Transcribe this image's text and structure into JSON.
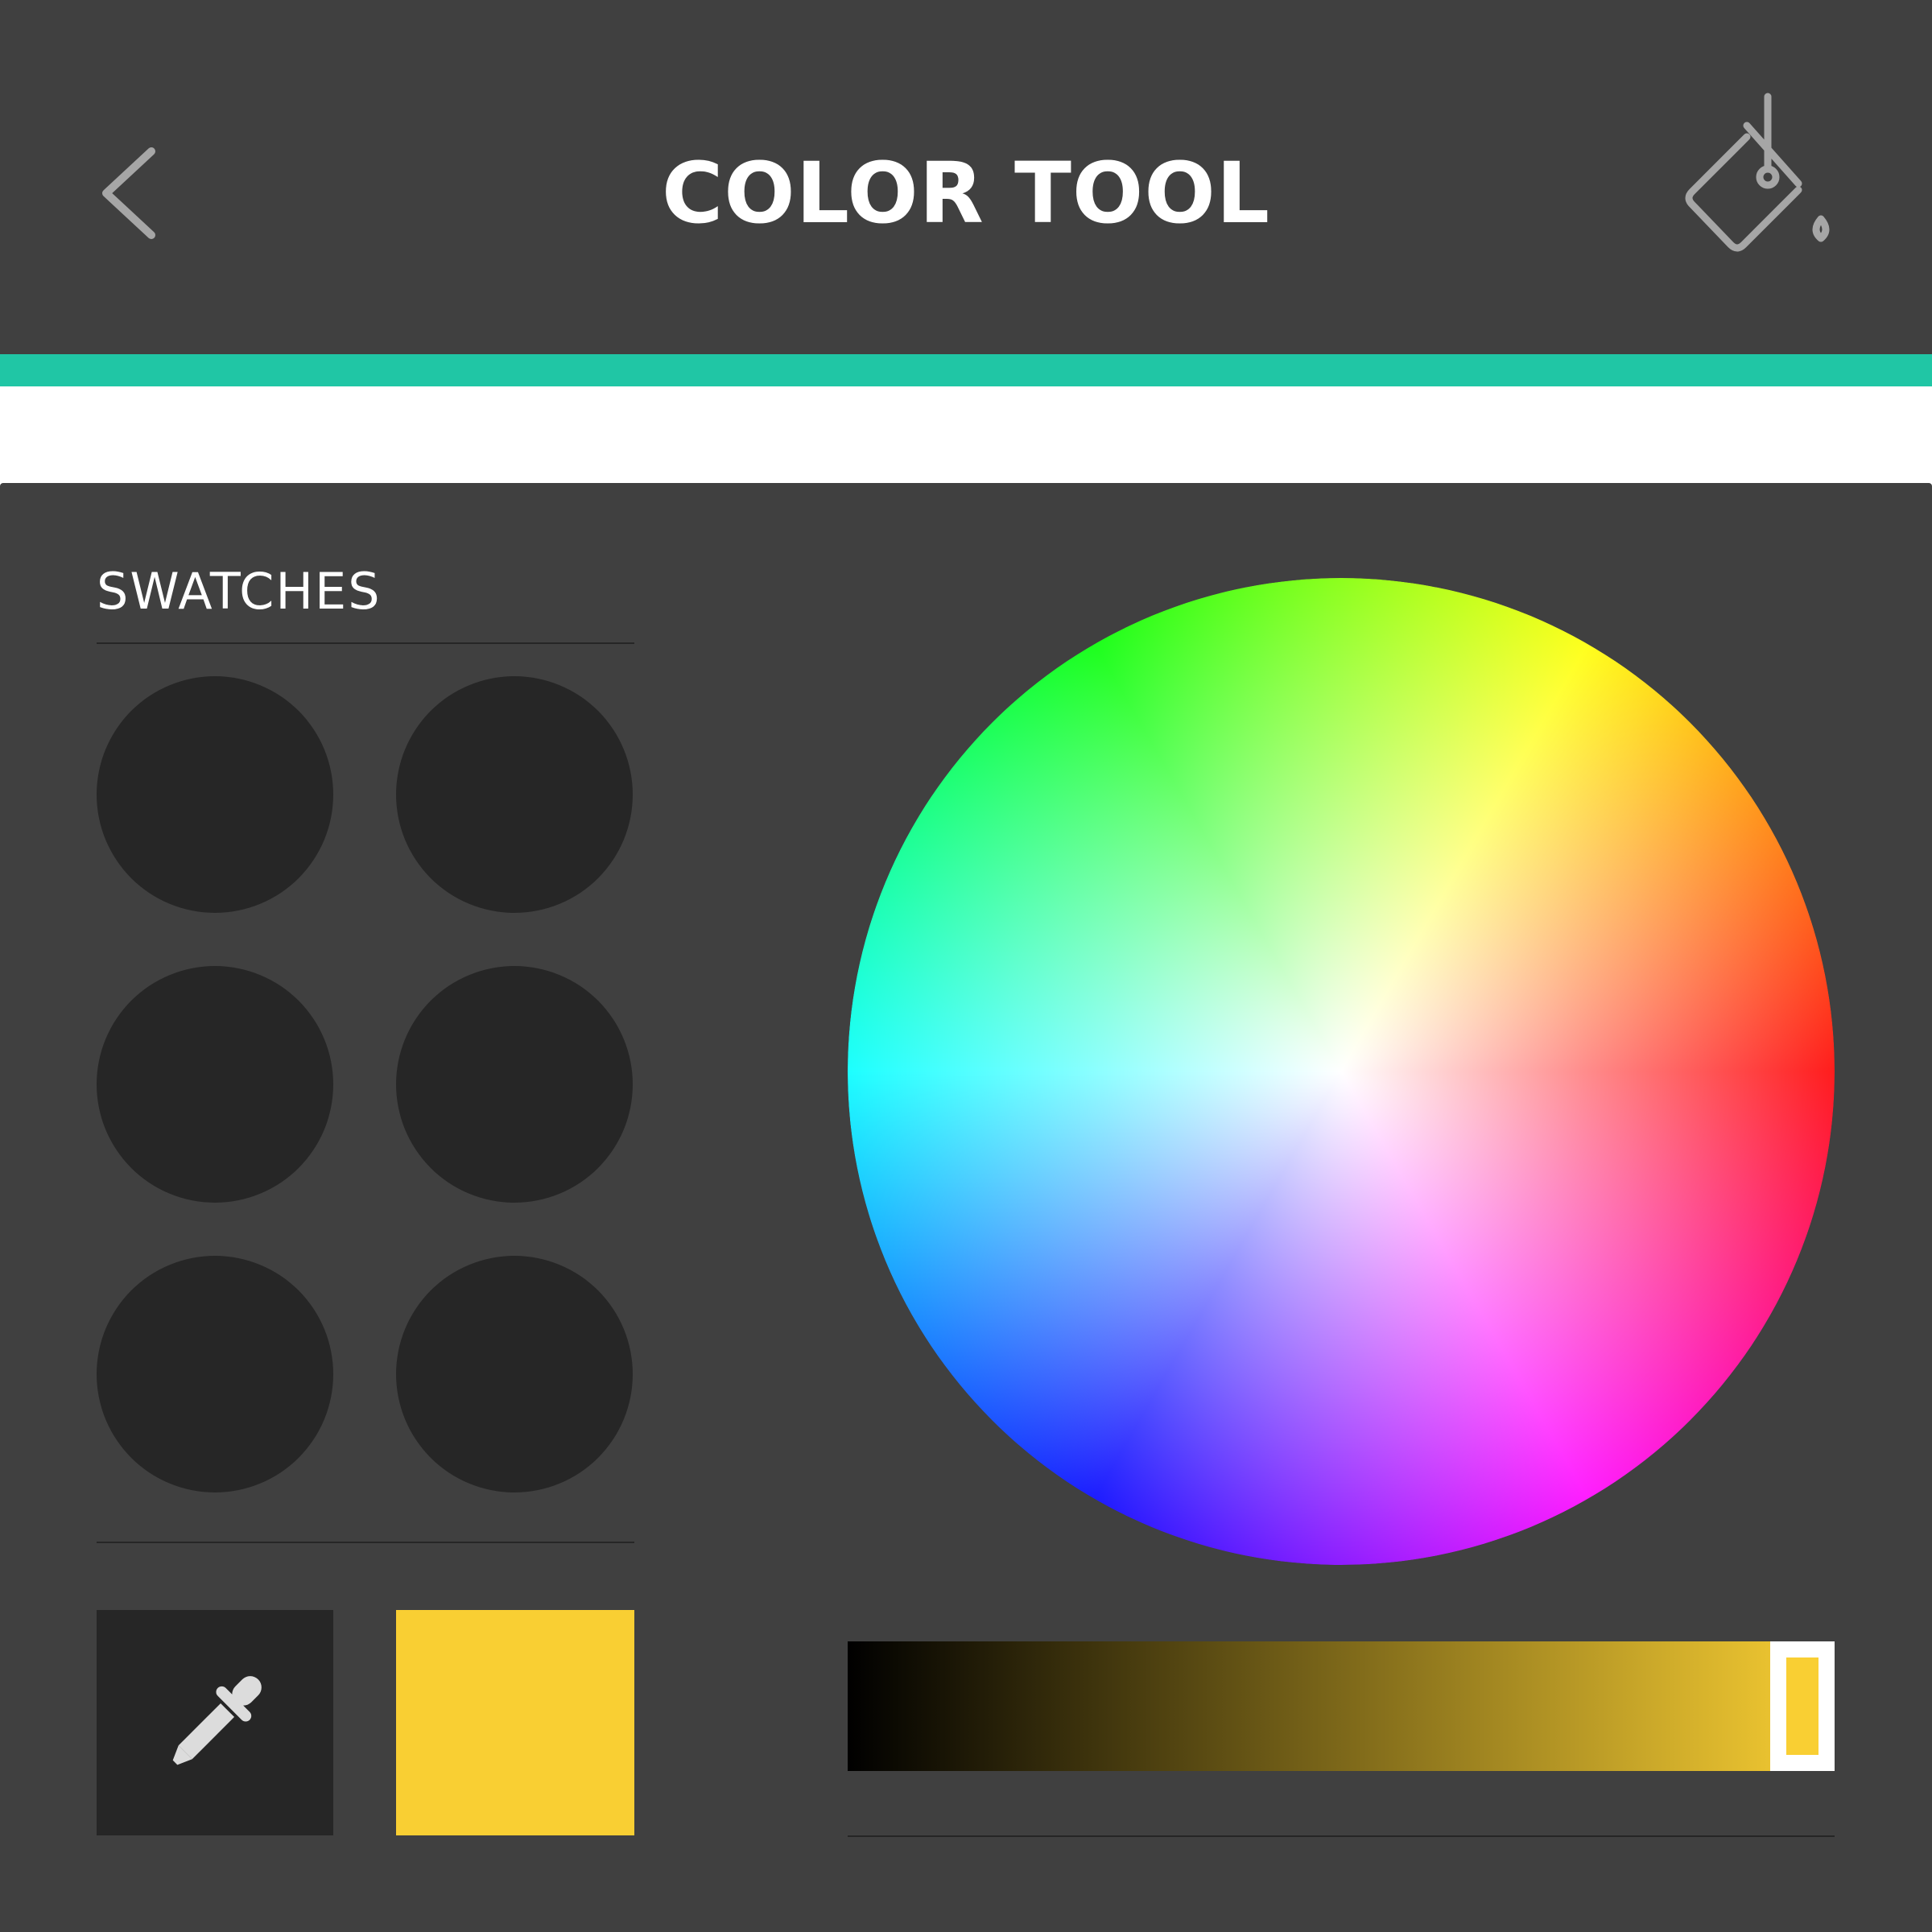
{
  "header": {
    "title": "COLOR TOOL",
    "back_icon": "chevron-left-icon",
    "fill_icon": "paint-bucket-icon"
  },
  "colors": {
    "header_bg": "#404040",
    "accent": "#20c6a5",
    "panel_bg": "#404040",
    "swatch_empty": "#262626",
    "selected": "#f9cf33",
    "icon_gray": "#a6a6a6"
  },
  "swatches": {
    "label": "SWATCHES",
    "count": 6
  },
  "tools": {
    "eyedropper_icon": "eyedropper-icon",
    "current_color": "#f9cf33"
  },
  "brightness": {
    "level": 1.0
  }
}
